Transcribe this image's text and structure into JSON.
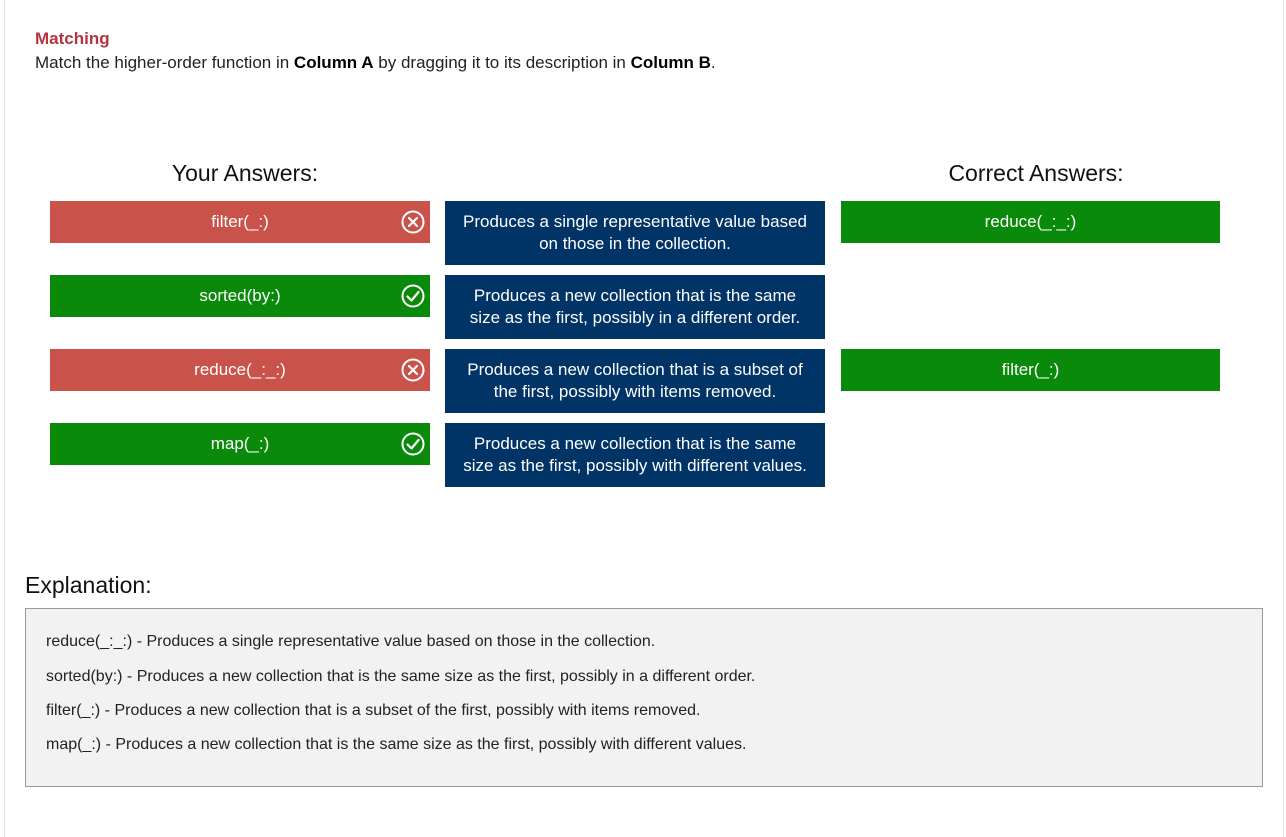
{
  "question": {
    "type_label": "Matching",
    "instruction_parts": [
      "Match the higher-order function in ",
      "Column A",
      " by dragging it to its description in ",
      "Column B",
      "."
    ]
  },
  "your_answers": {
    "heading": "Your Answers:",
    "items": [
      {
        "label": "filter(_:)",
        "status": "incorrect",
        "icon": "x-circle-icon"
      },
      {
        "label": "sorted(by:)",
        "status": "correct",
        "icon": "check-circle-icon"
      },
      {
        "label": "reduce(_:_:)",
        "status": "incorrect",
        "icon": "x-circle-icon"
      },
      {
        "label": "map(_:)",
        "status": "correct",
        "icon": "check-circle-icon"
      }
    ]
  },
  "descriptions": [
    "Produces a single representative value based on those in the collection.",
    "Produces a new collection that is the same size as the first, possibly in a different order.",
    "Produces a new collection that is a subset of the first, possibly with items removed.",
    "Produces a new collection that is the same size as the first, possibly with different values."
  ],
  "correct_answers": {
    "heading": "Correct Answers:",
    "items": [
      "reduce(_:_:)",
      "",
      "filter(_:)",
      ""
    ]
  },
  "explanation": {
    "heading": "Explanation:",
    "lines": [
      "reduce(_:_:) - Produces a single representative value based on those in the collection.",
      "sorted(by:) - Produces a new collection that is the same size as the first, possibly in a different order.",
      "filter(_:) - Produces a new collection that is a subset of the first, possibly with items removed.",
      "map(_:) - Produces a new collection that is the same size as the first, possibly with different values."
    ]
  },
  "colors": {
    "incorrect": "#c9534b",
    "correct": "#0a8a0a",
    "description": "#003366",
    "type_label": "#b5343f"
  }
}
